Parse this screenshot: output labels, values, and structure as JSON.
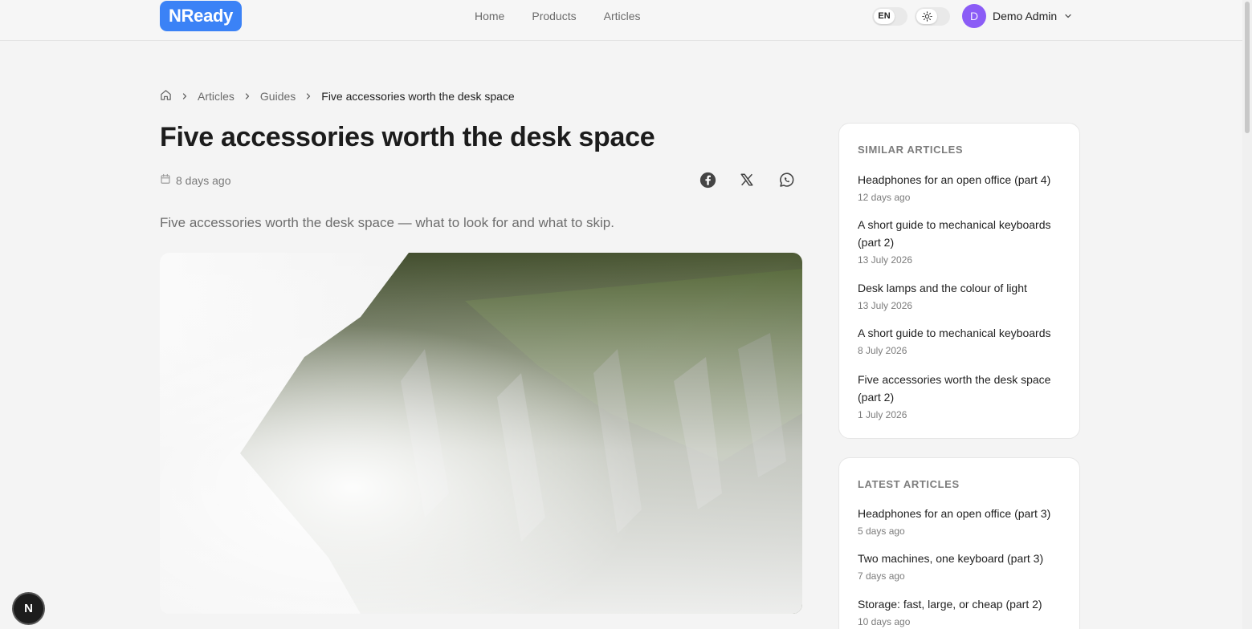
{
  "header": {
    "logo": "NReady",
    "nav": [
      "Home",
      "Products",
      "Articles"
    ],
    "language": "EN",
    "user": {
      "initial": "D",
      "name": "Demo Admin"
    }
  },
  "breadcrumb": {
    "items": [
      "Articles",
      "Guides"
    ],
    "current": "Five accessories worth the desk space"
  },
  "article": {
    "title": "Five accessories worth the desk space",
    "date": "8 days ago",
    "lead": "Five accessories worth the desk space — what to look for and what to skip."
  },
  "similar": {
    "heading": "SIMILAR ARTICLES",
    "items": [
      {
        "title": "Headphones for an open office (part 4)",
        "date": "12 days ago"
      },
      {
        "title": "A short guide to mechanical keyboards (part 2)",
        "date": "13 July 2026"
      },
      {
        "title": "Desk lamps and the colour of light",
        "date": "13 July 2026"
      },
      {
        "title": "A short guide to mechanical keyboards",
        "date": "8 July 2026"
      },
      {
        "title": "Five accessories worth the desk space (part 2)",
        "date": "1 July 2026"
      }
    ]
  },
  "latest": {
    "heading": "LATEST ARTICLES",
    "items": [
      {
        "title": "Headphones for an open office (part 3)",
        "date": "5 days ago"
      },
      {
        "title": "Two machines, one keyboard (part 3)",
        "date": "7 days ago"
      },
      {
        "title": "Storage: fast, large, or cheap (part 2)",
        "date": "10 days ago"
      }
    ]
  },
  "dev_badge": "N",
  "colors": {
    "brand": "#3b82f6",
    "avatar": "#8b5cf6"
  }
}
